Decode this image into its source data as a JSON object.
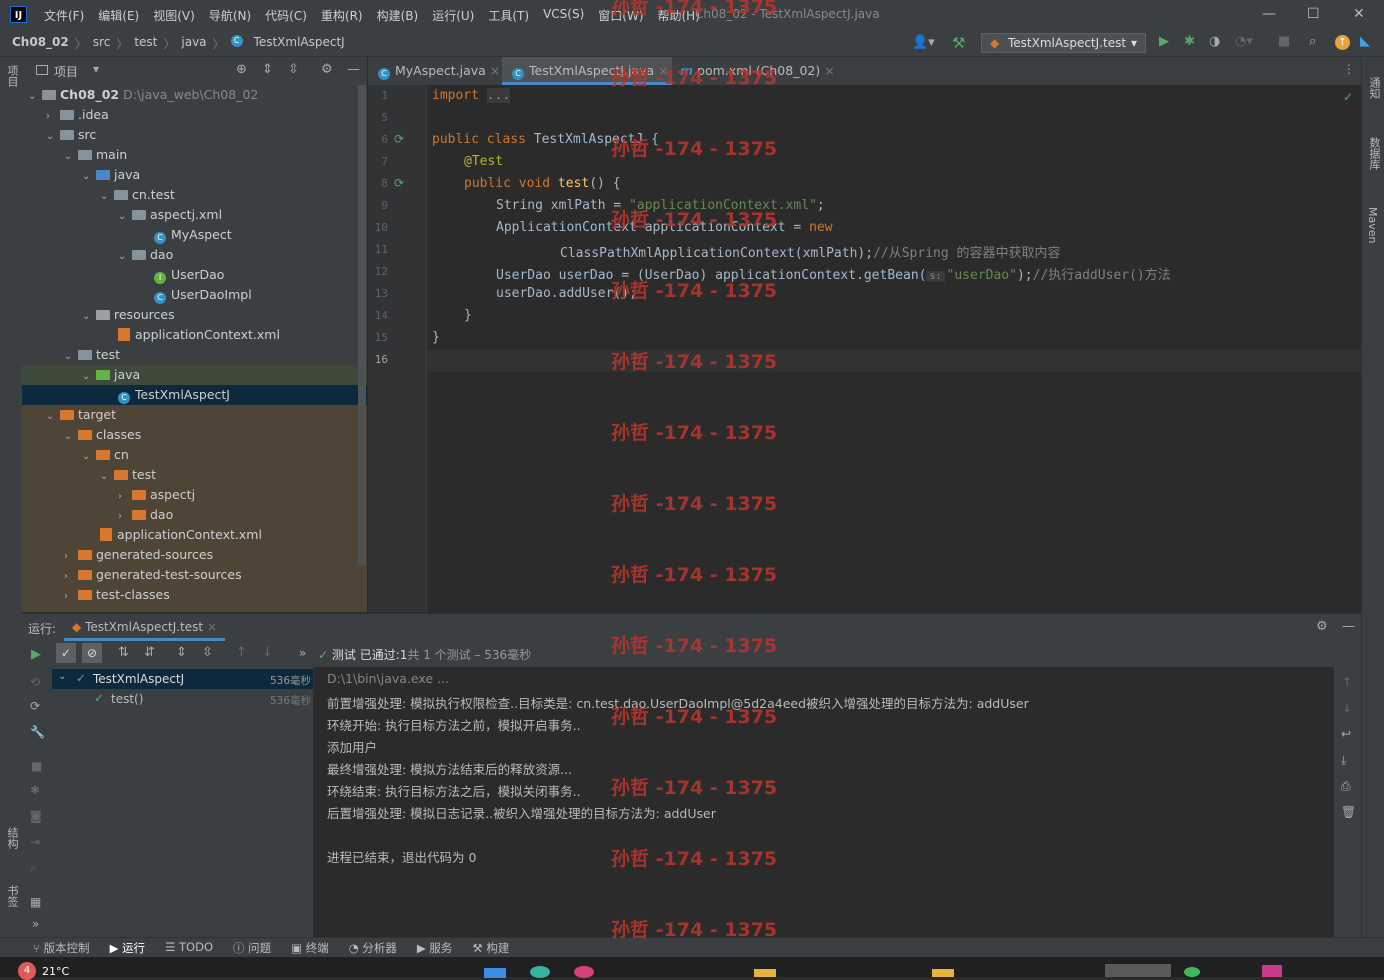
{
  "app": {
    "menus": [
      "文件(F)",
      "编辑(E)",
      "视图(V)",
      "导航(N)",
      "代码(C)",
      "重构(R)",
      "构建(B)",
      "运行(U)",
      "工具(T)",
      "VCS(S)",
      "窗口(W)",
      "帮助(H)"
    ],
    "title": "Ch08_02 - TestXmlAspectJ.java"
  },
  "breadcrumb": [
    "Ch08_02",
    "src",
    "test",
    "java",
    "TestXmlAspectJ"
  ],
  "run_config": "TestXmlAspectJ.test",
  "left_strip": {
    "project": "项目",
    "structure": "结构",
    "bookmarks": "书签"
  },
  "right_strip": {
    "notifications": "通知",
    "database": "数据库",
    "maven": "Maven"
  },
  "project_panel": {
    "title": "项目",
    "tree": [
      {
        "label": "Ch08_02",
        "path": "D:\\java_web\\Ch08_02"
      },
      {
        "label": ".idea"
      },
      {
        "label": "src"
      },
      {
        "label": "main"
      },
      {
        "label": "java"
      },
      {
        "label": "cn.test"
      },
      {
        "label": "aspectj.xml"
      },
      {
        "label": "MyAspect"
      },
      {
        "label": "dao"
      },
      {
        "label": "UserDao"
      },
      {
        "label": "UserDaoImpl"
      },
      {
        "label": "resources"
      },
      {
        "label": "applicationContext.xml"
      },
      {
        "label": "test"
      },
      {
        "label": "java"
      },
      {
        "label": "TestXmlAspectJ"
      },
      {
        "label": "target"
      },
      {
        "label": "classes"
      },
      {
        "label": "cn"
      },
      {
        "label": "test"
      },
      {
        "label": "aspectj"
      },
      {
        "label": "dao"
      },
      {
        "label": "applicationContext.xml"
      },
      {
        "label": "generated-sources"
      },
      {
        "label": "generated-test-sources"
      },
      {
        "label": "test-classes"
      }
    ]
  },
  "editor": {
    "tabs": [
      "MyAspect.java",
      "TestXmlAspectJ.java",
      "pom.xml (Ch08_02)"
    ],
    "line_numbers": [
      "1",
      "5",
      "6",
      "7",
      "8",
      "9",
      "10",
      "11",
      "12",
      "13",
      "14",
      "15",
      "16"
    ],
    "code": {
      "l1_kw": "import",
      "l1_fold": "...",
      "l6_kw": "public class",
      "l6_rest": " TestXmlAspectJ {",
      "l7": "@Test",
      "l8_kw": "public void",
      "l8_fn": "test",
      "l8_rest": "() {",
      "l9_a": "String xmlPath = ",
      "l9_str": "\"applicationContext.xml\"",
      "l9_b": ";",
      "l10_a": "ApplicationContext applicationContext = ",
      "l10_kw": "new",
      "l11_a": "ClassPathXmlApplicationContext(xmlPath);",
      "l11_cm": "//从Spring 的容器中获取内容",
      "l12_a": "UserDao userDao = (UserDao) applicationContext.getBean(",
      "l12_hint": "s:",
      "l12_str": "\"userDao\"",
      "l12_b": ");",
      "l12_cm": "//执行addUser()方法",
      "l13": "userDao.addUser();",
      "l14": "}",
      "l15": "}"
    }
  },
  "run_panel": {
    "label": "运行:",
    "tab": "TestXmlAspectJ.test",
    "status_prefix": "测试 已通过:",
    "status_count": "1",
    "status_suffix": "共 1 个测试 – 536毫秒",
    "tests": [
      {
        "name": "TestXmlAspectJ",
        "time": "536毫秒"
      },
      {
        "name": "test()",
        "time": "536毫秒"
      }
    ],
    "console": [
      "D:\\1\\bin\\java.exe ...",
      "前置增强处理: 模拟执行权限检查..目标类是: cn.test.dao.UserDaoImpl@5d2a4eed被织入增强处理的目标方法为: addUser",
      "环绕开始: 执行目标方法之前，模拟开启事务..",
      "添加用户",
      "最终增强处理: 模拟方法结束后的释放资源...",
      "环绕结束: 执行目标方法之后，模拟关闭事务..",
      "后置增强处理: 模拟日志记录..被织入增强处理的目标方法为: addUser",
      "",
      "进程已结束，退出代码为 0"
    ]
  },
  "bottom_tabs": [
    "版本控制",
    "运行",
    "TODO",
    "问题",
    "终端",
    "分析器",
    "服务",
    "构建"
  ],
  "taskbar": {
    "weather": "21°C",
    "badge": "4"
  },
  "watermark": "孙哲 -174 - 1375"
}
